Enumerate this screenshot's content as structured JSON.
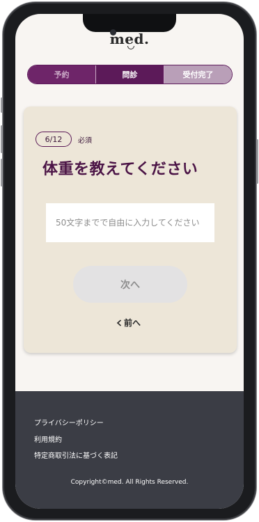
{
  "logo": "med.",
  "steps": [
    {
      "label": "予約",
      "state": "done"
    },
    {
      "label": "問診",
      "state": "current"
    },
    {
      "label": "受付完了",
      "state": "todo"
    }
  ],
  "question": {
    "progress": "6/12",
    "required": "必須",
    "title": "体重を教えてください",
    "input_placeholder": "50文字までで自由に入力してください",
    "input_value": ""
  },
  "actions": {
    "next_label": "次へ",
    "prev_label": "前へ"
  },
  "footer": {
    "links": [
      "プライバシーポリシー",
      "利用規約",
      "特定商取引法に基づく表記"
    ],
    "copyright": "Copyright©med. All Rights Reserved."
  },
  "colors": {
    "brand": "#5c1a59",
    "card": "#ede6d8",
    "footer": "#3b3d45"
  }
}
